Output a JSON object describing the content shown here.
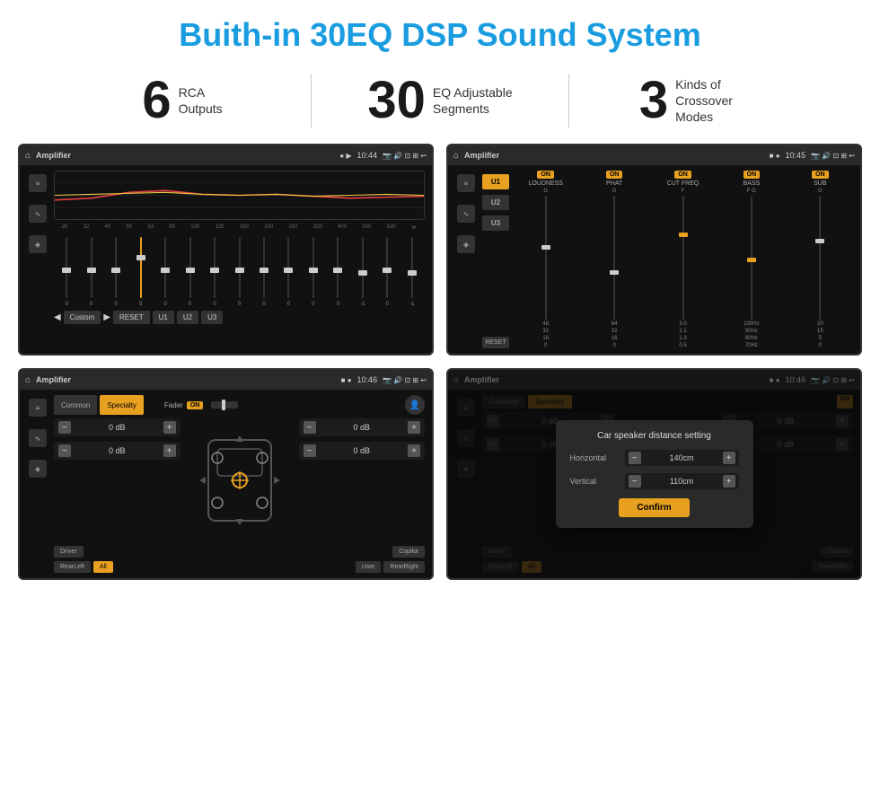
{
  "page": {
    "title": "Buith-in 30EQ DSP Sound System"
  },
  "stats": [
    {
      "number": "6",
      "label_line1": "RCA",
      "label_line2": "Outputs"
    },
    {
      "number": "30",
      "label_line1": "EQ Adjustable",
      "label_line2": "Segments"
    },
    {
      "number": "3",
      "label_line1": "Kinds of",
      "label_line2": "Crossover Modes"
    }
  ],
  "screens": {
    "eq": {
      "title": "Amplifier",
      "time": "10:44",
      "freqs": [
        "25",
        "32",
        "40",
        "50",
        "63",
        "80",
        "100",
        "125",
        "160",
        "200",
        "250",
        "320",
        "400",
        "500",
        "630"
      ],
      "values": [
        "0",
        "0",
        "0",
        "5",
        "0",
        "0",
        "0",
        "0",
        "0",
        "0",
        "0",
        "0",
        "-1",
        "0",
        "-1"
      ],
      "buttons": [
        "Custom",
        "RESET",
        "U1",
        "U2",
        "U3"
      ]
    },
    "crossover": {
      "title": "Amplifier",
      "time": "10:45",
      "presets": [
        "U1",
        "U2",
        "U3"
      ],
      "channels": [
        {
          "name": "LOUDNESS",
          "toggle": "ON"
        },
        {
          "name": "PHAT",
          "toggle": "ON"
        },
        {
          "name": "CUT FREQ",
          "toggle": "ON"
        },
        {
          "name": "BASS",
          "toggle": "ON"
        },
        {
          "name": "SUB",
          "toggle": "ON"
        }
      ],
      "reset_label": "RESET"
    },
    "fader": {
      "title": "Amplifier",
      "time": "10:46",
      "tabs": [
        "Common",
        "Specialty"
      ],
      "fader_label": "Fader",
      "fader_on": "ON",
      "db_values": [
        "0 dB",
        "0 dB",
        "0 dB",
        "0 dB"
      ],
      "bottom_btns": [
        "Driver",
        "RearLeft",
        "All",
        "Copilot",
        "User",
        "RearRight"
      ]
    },
    "distance": {
      "title": "Amplifier",
      "time": "10:46",
      "tabs": [
        "Common",
        "Specialty"
      ],
      "dialog_title": "Car speaker distance setting",
      "horizontal_label": "Horizontal",
      "horizontal_value": "140cm",
      "vertical_label": "Vertical",
      "vertical_value": "110cm",
      "confirm_btn": "Confirm",
      "db_values": [
        "0 dB",
        "0 dB"
      ],
      "bottom_btns": [
        "Driver",
        "RearLeft",
        "All",
        "Copilot",
        "RearRight"
      ]
    }
  },
  "icons": {
    "home": "⌂",
    "back": "↩",
    "location": "📍",
    "camera": "📷",
    "volume": "🔊",
    "screen": "⊡",
    "equalizer": "≡",
    "waveform": "∿",
    "speaker": "◈",
    "minus": "−",
    "plus": "+"
  }
}
